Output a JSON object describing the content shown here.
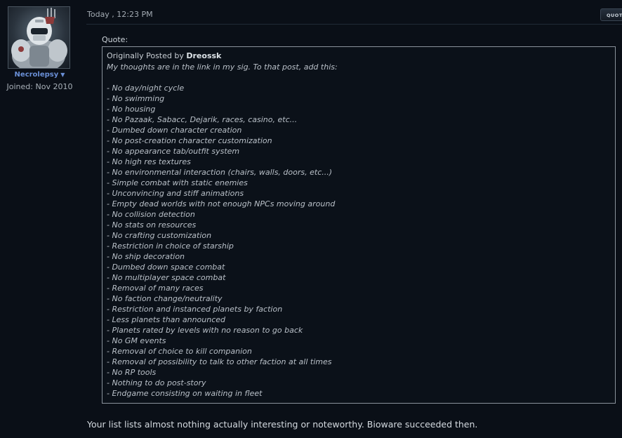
{
  "user": {
    "username": "Necrolepsy",
    "caret": "▼",
    "joined": "Joined: Nov 2010",
    "avatar_icon": "armored-trooper-avatar"
  },
  "post": {
    "date": "Today , 12:23 PM",
    "quote_button": "QUOTE"
  },
  "quote": {
    "label": "Quote:",
    "originally_posted_by": "Originally Posted by",
    "author": "Dreossk",
    "lines": [
      "My thoughts are in the link in my sig. To that post, add this:",
      "",
      "- No day/night cycle",
      "- No swimming",
      "- No housing",
      "- No Pazaak, Sabacc, Dejarik, races, casino, etc...",
      "- Dumbed down character creation",
      "- No post-creation character customization",
      "- No appearance tab/outfit system",
      "- No high res textures",
      "- No environmental interaction (chairs, walls, doors, etc...)",
      "- Simple combat with static enemies",
      "- Unconvincing and stiff animations",
      "- Empty dead worlds with not enough NPCs moving around",
      "- No collision detection",
      "- No stats on resources",
      "- No crafting customization",
      "- Restriction in choice of starship",
      "- No ship decoration",
      "- Dumbed down space combat",
      "- No multiplayer space combat",
      "- Removal of many races",
      "- No faction change/neutrality",
      "- Restriction and instanced planets by faction",
      "- Less planets than announced",
      "- Planets rated by levels with no reason to go back",
      "- No GM events",
      "- Removal of choice to kill companion",
      "- Removal of possibility to talk to other faction at all times",
      "- No RP tools",
      "- Nothing to do post-story",
      "- Endgame consisting on waiting in fleet"
    ]
  },
  "reply": {
    "text": "Your list lists almost nothing actually interesting or noteworthy. Bioware succeeded then."
  },
  "colors": {
    "background": "#0a0f17",
    "username": "#6a8fd6",
    "quote_border": "#8a939c"
  }
}
